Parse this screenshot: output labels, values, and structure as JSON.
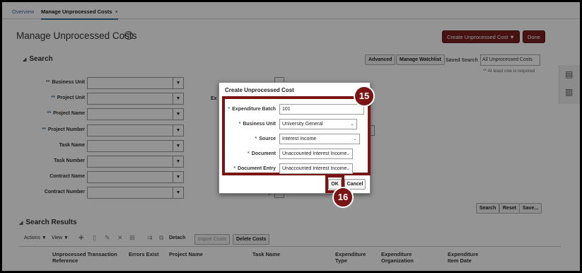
{
  "tabs": [
    {
      "label": "Overview"
    },
    {
      "label": "Manage Unprocessed Costs",
      "close": "×"
    }
  ],
  "page": {
    "title": "Manage Unprocessed Costs",
    "help": "?"
  },
  "header_buttons": {
    "create": "Create Unprocessed Cost ▼",
    "done": "Done"
  },
  "search": {
    "title": "Search",
    "advanced": "Advanced",
    "watchlist": "Manage Watchlist",
    "saved_label": "Saved Search",
    "saved_value": "All Unprocessed Costs",
    "required_note": "** At least one is required",
    "fields": [
      {
        "label": "Business Unit",
        "req": "**"
      },
      {
        "label": "Project Unit",
        "req": "**"
      },
      {
        "label": "Project Name",
        "req": "**"
      },
      {
        "label": "Project Number",
        "req": "**"
      },
      {
        "label": "Task Name",
        "req": ""
      },
      {
        "label": "Task Number",
        "req": ""
      },
      {
        "label": "Contract Name",
        "req": ""
      },
      {
        "label": "Contract Number",
        "req": ""
      }
    ],
    "partial_label_1": "Ex",
    "partial_label_2": "Document Entry",
    "buttons": {
      "search": "Search",
      "reset": "Reset",
      "save": "Save..."
    }
  },
  "results": {
    "title": "Search Results",
    "actions": "Actions ▼",
    "view": "View ▼",
    "detach": "Detach",
    "import": "Import Costs",
    "delete": "Delete Costs",
    "columns": [
      "Unprocessed Transaction Reference",
      "Errors Exist",
      "Project Name",
      "Task Name",
      "Expenditure Type",
      "Expenditure Organization",
      "Expenditure Item Date"
    ]
  },
  "dialog": {
    "title": "Create Unprocessed Cost",
    "fields": [
      {
        "label": "Expenditure Batch",
        "req": "*",
        "value": "101"
      },
      {
        "label": "Business Unit",
        "req": "*",
        "value": "University General"
      },
      {
        "label": "Source",
        "req": "*",
        "value": "Interest Income"
      },
      {
        "label": "Document",
        "req": "*",
        "value": "Unaccounted Interest Income"
      },
      {
        "label": "Document Entry",
        "req": "*",
        "value": "Unaccounted Interest Income"
      }
    ],
    "ok": "OK",
    "cancel": "Cancel"
  },
  "callouts": {
    "step1": "15",
    "step2": "16"
  },
  "colors": {
    "accent": "#7a1515",
    "link": "#3a6fa0"
  },
  "icons": [
    "help-icon",
    "plus-icon",
    "trash-icon",
    "edit-icon",
    "close-icon",
    "freeze-icon",
    "wrap-icon",
    "detach-icon",
    "document-icon",
    "chart-icon",
    "chevron-down-icon"
  ]
}
